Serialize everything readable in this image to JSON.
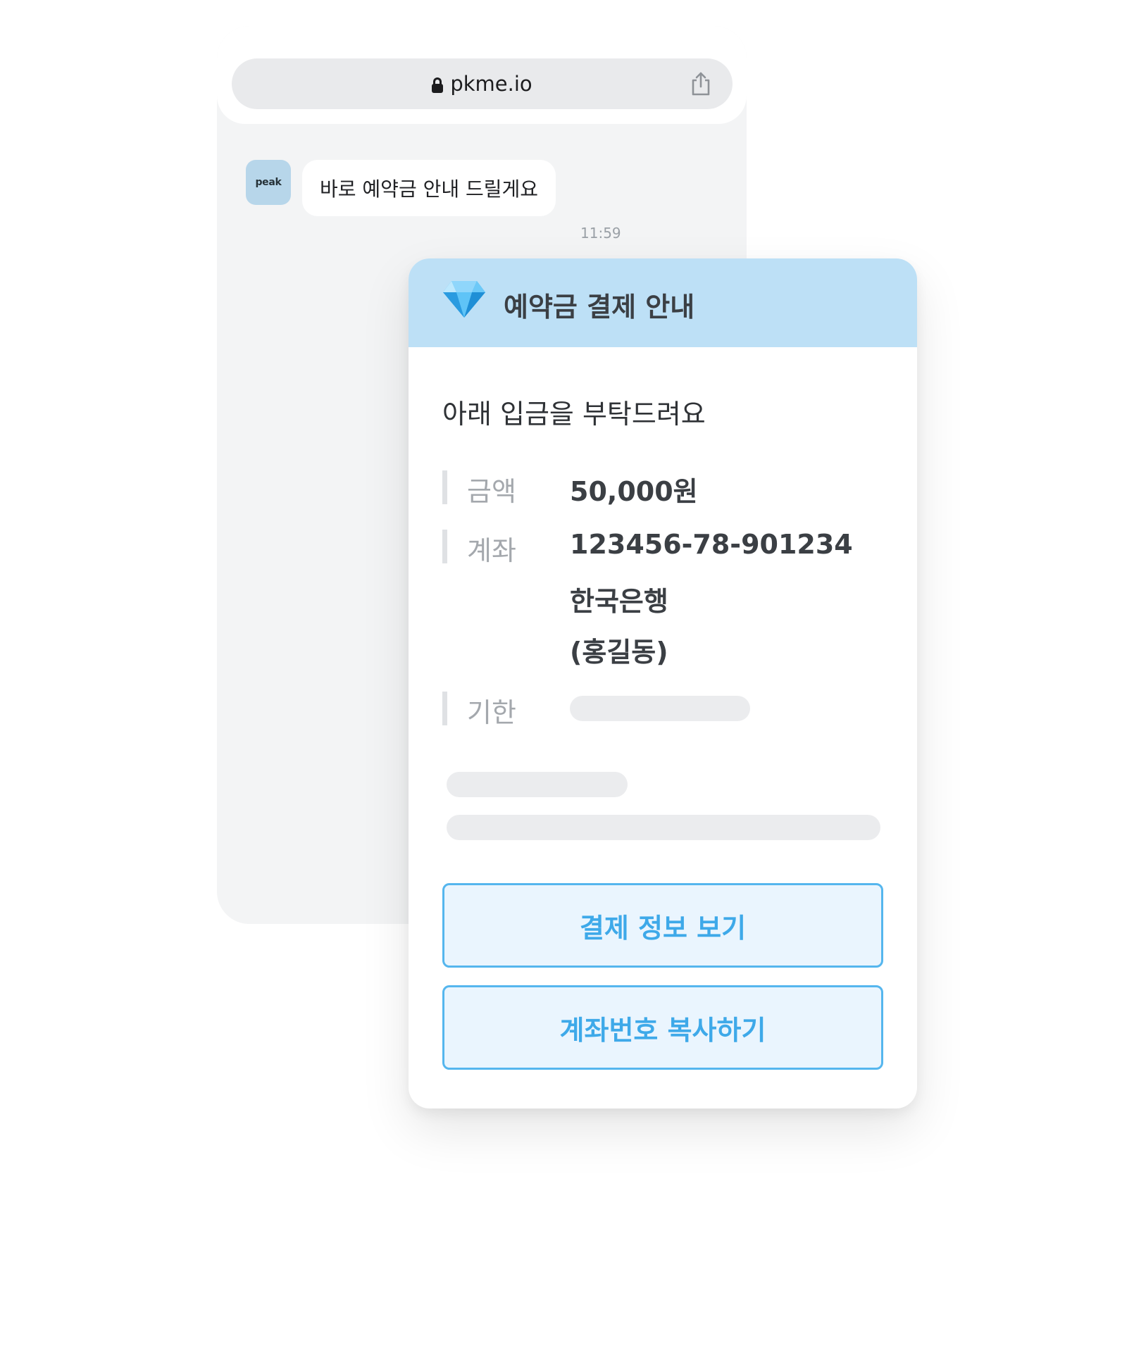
{
  "browser": {
    "url": "pkme.io",
    "lock_icon": "lock-icon",
    "share_icon": "share-icon"
  },
  "chat": {
    "avatar_text": "peak",
    "message": "바로 예약금 안내 드릴게요",
    "time": "11:59"
  },
  "card": {
    "header_icon": "gem-icon",
    "title": "예약금 결제 안내",
    "subtitle": "아래 입금을 부탁드려요",
    "rows": [
      {
        "label": "금액",
        "value": "50,000원"
      },
      {
        "label": "계좌",
        "value": "123456-78-901234",
        "value_line2": "한국은행",
        "value_line3": "(홍길동)"
      },
      {
        "label": "기한",
        "value": ""
      }
    ],
    "buttons": {
      "view_payment": "결제 정보 보기",
      "copy_account": "계좌번호 복사하기"
    }
  },
  "colors": {
    "header_bg": "#bde0f6",
    "accent": "#55b6ee",
    "button_text": "#3ea9e9",
    "button_bg": "#eaf5fe"
  }
}
